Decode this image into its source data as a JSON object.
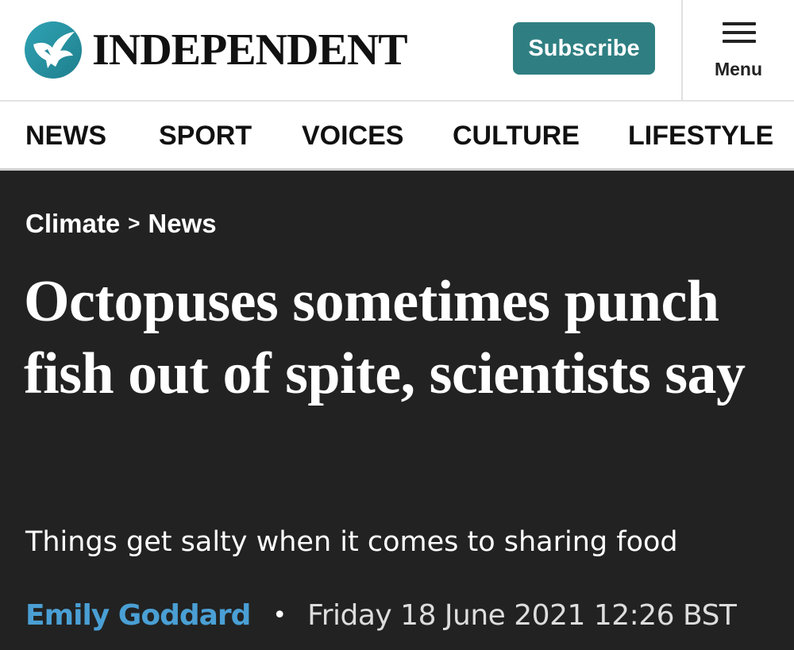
{
  "header": {
    "logo_text": "INDEPENDENT",
    "subscribe_label": "Subscribe",
    "menu_label": "Menu"
  },
  "nav": {
    "items": [
      "NEWS",
      "SPORT",
      "VOICES",
      "CULTURE",
      "LIFESTYLE"
    ]
  },
  "article": {
    "breadcrumb": {
      "section": "Climate",
      "separator": ">",
      "subsection": "News"
    },
    "headline": "Octopuses sometimes punch fish out of spite, scientists say",
    "standfirst": "Things get salty when it comes to sharing food",
    "author": "Emily Goddard",
    "byline_separator": "•",
    "date": "Friday 18 June 2021 12:26 BST"
  },
  "colors": {
    "brand_teal": "#2f7f82",
    "article_background": "#222222",
    "author_link": "#4a9fd4"
  },
  "icons": {
    "logo": "eagle-logo-icon",
    "menu": "hamburger-menu-icon"
  }
}
